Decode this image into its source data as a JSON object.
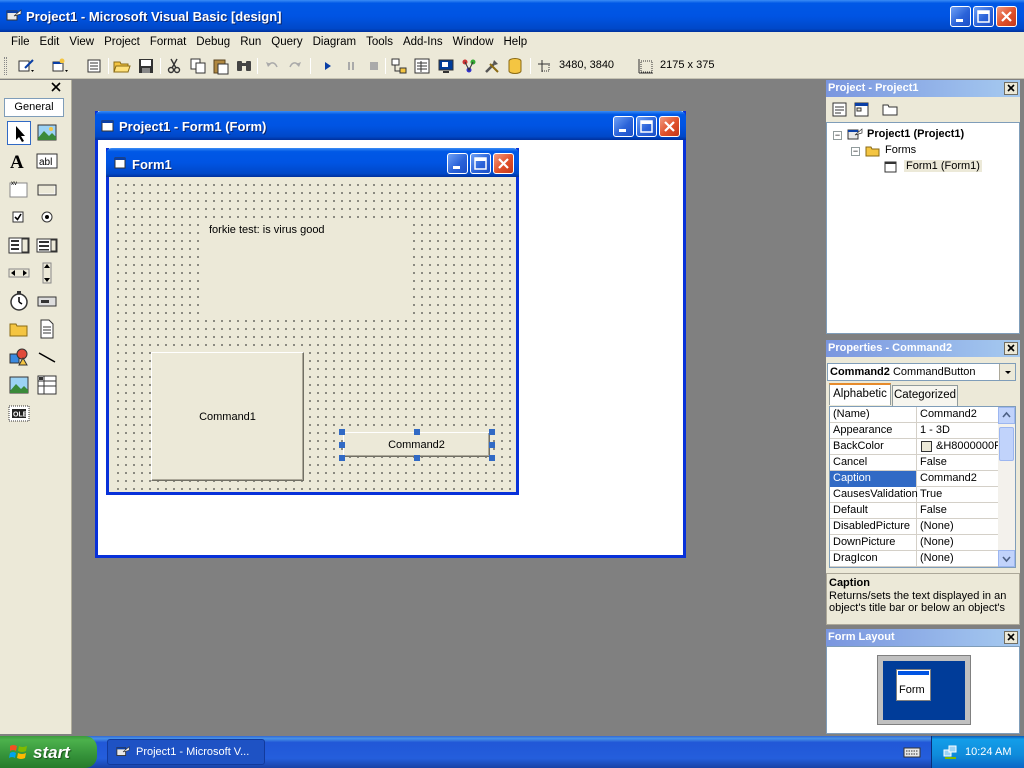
{
  "window": {
    "title": "Project1 - Microsoft Visual Basic [design]"
  },
  "menu": [
    "File",
    "Edit",
    "View",
    "Project",
    "Format",
    "Debug",
    "Run",
    "Query",
    "Diagram",
    "Tools",
    "Add-Ins",
    "Window",
    "Help"
  ],
  "toolbar": {
    "position_readout": "3480, 3840",
    "size_readout": "2175 x 375"
  },
  "toolbox": {
    "tab_label": "General",
    "tools": [
      "pointer-icon",
      "picturebox-icon",
      "label-icon",
      "textbox-icon",
      "frame-icon",
      "commandbutton-icon",
      "checkbox-icon",
      "optionbutton-icon",
      "combobox-icon",
      "listbox-icon",
      "hscrollbar-icon",
      "vscrollbar-icon",
      "timer-icon",
      "drivelistbox-icon",
      "dirlistbox-icon",
      "filelistbox-icon",
      "shape-icon",
      "line-icon",
      "image-icon",
      "data-icon",
      "ole-icon"
    ]
  },
  "designer": {
    "title": "Project1 - Form1 (Form)"
  },
  "form1": {
    "title": "Form1",
    "label_caption": "forkie test: is virus good",
    "command1_caption": "Command1",
    "command2_caption": "Command2"
  },
  "project_pane": {
    "title": "Project - Project1",
    "root": "Project1 (Project1)",
    "folder": "Forms",
    "item": "Form1 (Form1)"
  },
  "properties_pane": {
    "title": "Properties - Command2",
    "object_name": "Command2",
    "object_type": "CommandButton",
    "tabs": [
      "Alphabetic",
      "Categorized"
    ],
    "rows": [
      {
        "name": "(Name)",
        "value": "Command2"
      },
      {
        "name": "Appearance",
        "value": "1 - 3D"
      },
      {
        "name": "BackColor",
        "value": "&H8000000F"
      },
      {
        "name": "Cancel",
        "value": "False"
      },
      {
        "name": "Caption",
        "value": "Command2"
      },
      {
        "name": "CausesValidation",
        "value": "True"
      },
      {
        "name": "Default",
        "value": "False"
      },
      {
        "name": "DisabledPicture",
        "value": "(None)"
      },
      {
        "name": "DownPicture",
        "value": "(None)"
      },
      {
        "name": "DragIcon",
        "value": "(None)"
      }
    ],
    "selected_row": "Caption",
    "description_title": "Caption",
    "description_text": "Returns/sets the text displayed in an object's title bar or below an object's"
  },
  "form_layout_pane": {
    "title": "Form Layout",
    "form_label": "Form"
  },
  "taskbar": {
    "start_label": "start",
    "task_label": "Project1 - Microsoft V...",
    "clock": "10:24 AM"
  },
  "colors": {
    "xp_blue": "#0054e3",
    "face": "#ece9d8",
    "selection": "#316ac5",
    "start_green": "#35933a"
  }
}
